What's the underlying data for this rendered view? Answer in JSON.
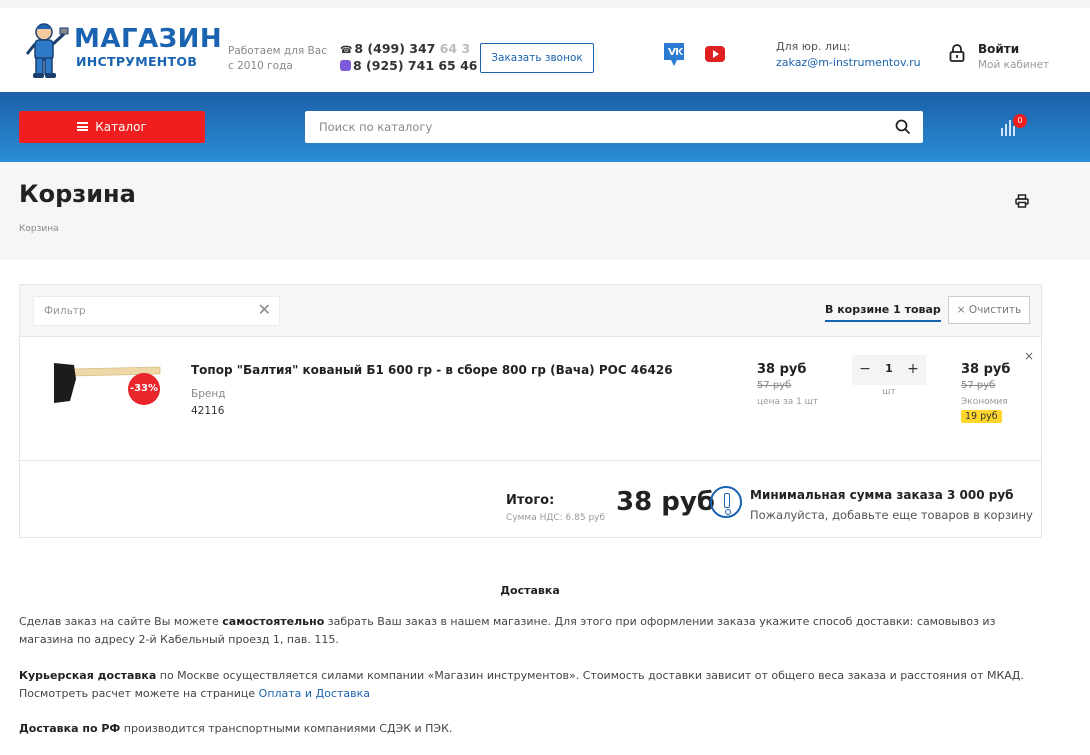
{
  "header": {
    "logo_line1": "МАГАЗИН",
    "logo_line2": "ИНСТРУМЕНТОВ",
    "since_line1": "Работаем для Вас",
    "since_line2": "с 2010 года",
    "phone1_main": "8 (499) 347",
    "phone1_faded": " 64 3",
    "phone2": "8 (925) 741 65 46",
    "callback_label": "Заказать звонок",
    "legal_label": "Для юр. лиц:",
    "legal_email": "zakaz@m-instrumentov.ru",
    "login_title": "Войти",
    "login_sub": "Мой кабинет"
  },
  "nav": {
    "catalog_label": "Каталог",
    "search_placeholder": "Поиск по каталогу",
    "cart_count": "0"
  },
  "page": {
    "title": "Корзина",
    "breadcrumb": "Корзина"
  },
  "cart": {
    "filter_placeholder": "Фильтр",
    "in_cart_label": "В корзине 1 товар",
    "clear_label": "× Очистить",
    "item": {
      "name": "Топор \"Балтия\" кованый Б1 600 гр - в сборе 800 гр (Вача) РОС 46426",
      "brand_label": "Бренд",
      "brand_code": "42116",
      "discount": "-33%",
      "price": "38 руб",
      "old_price": "57 руб",
      "per_unit": "цена за 1 шт",
      "quantity": "1",
      "unit": "шт",
      "total_price": "38 руб",
      "total_old": "57 руб",
      "economy_label": "Экономия",
      "economy_value": "19 руб",
      "remove": "×"
    },
    "summary": {
      "label": "Итого:",
      "vat": "Сумма НДС: 6.85 руб",
      "total": "38 руб",
      "min_title": "Минимальная сумма заказа 3 000 руб",
      "min_text": "Пожалуйста, добавьте еще товаров в корзину"
    }
  },
  "delivery": {
    "title": "Доставка",
    "p1_pre": "Сделав заказ на сайте Вы можете ",
    "p1_bold": "самостоятельно",
    "p1_post": " забрать Ваш заказ в нашем магазине. Для этого при оформлении заказа укажите способ доставки: самовывоз из магазина по адресу 2-й Кабельный проезд 1, пав. 115.",
    "p2_bold": "Курьерская доставка",
    "p2_mid": " по Москве осуществляется силами компании «Магазин инструментов». Стоимость доставки зависит от общего веса заказа и расстояния от МКАД. Посмотреть расчет можете на странице ",
    "p2_link": "Оплата и Доставка",
    "p3_bold": "Доставка по РФ",
    "p3_post": " производится транспортными компаниями СДЭК и ПЭК."
  },
  "colors": {
    "brand_blue": "#1a63b0",
    "catalog_red": "#f01e1e",
    "economy_yellow": "#ffd62e"
  }
}
